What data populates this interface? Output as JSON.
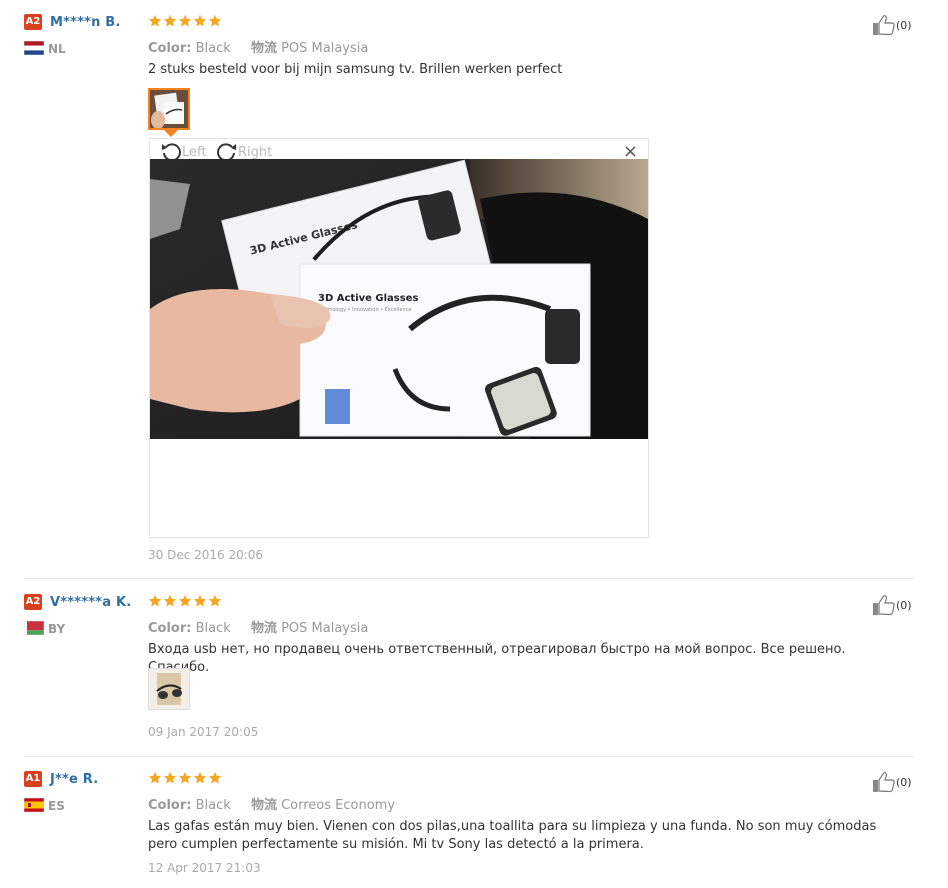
{
  "icons": {
    "rating": "star-icon",
    "helpful": "thumbs-up-icon",
    "rotate_left": "rotate-left-icon",
    "rotate_right": "rotate-right-icon",
    "close": "close-icon"
  },
  "colors": {
    "star": "#f5a623",
    "username": "#2f6ea3",
    "badge": "#d9411e",
    "active_thumb_border": "#f5811f"
  },
  "viewer": {
    "left_label": "Left",
    "right_label": "Right",
    "close_label": "×"
  },
  "reviews": [
    {
      "badge": "A2",
      "username": "M****n B.",
      "country": "NL",
      "flag": "netherlands",
      "rating": 5,
      "color_label": "Color:",
      "color_value": "Black",
      "shipping_label": "物流",
      "shipping_value": "POS Malaysia",
      "text": "2 stuks besteld voor bij mijn samsung tv. Brillen werken perfect",
      "photo_text_1": "3D Active Glasses",
      "photo_text_2": "3D Active Glasses",
      "photo_subtext": "Technology • Innovation • Excellence",
      "date": "30 Dec 2016 20:06",
      "likes": "(0)"
    },
    {
      "badge": "A2",
      "username": "V******a K.",
      "country": "BY",
      "flag": "belarus",
      "rating": 5,
      "color_label": "Color:",
      "color_value": "Black",
      "shipping_label": "物流",
      "shipping_value": "POS Malaysia",
      "text": "Входа usb нет, но продавец очень ответственный, отреагировал быстро на мой вопрос. Все решено. Спасибо.",
      "date": "09 Jan 2017 20:05",
      "likes": "(0)"
    },
    {
      "badge": "A1",
      "username": "J**e R.",
      "country": "ES",
      "flag": "spain",
      "rating": 5,
      "color_label": "Color:",
      "color_value": "Black",
      "shipping_label": "物流",
      "shipping_value": "Correos Economy",
      "text": "Las gafas están muy bien. Vienen con dos pilas,una toallita para su limpieza y una funda. No son muy cómodas pero cumplen perfectamente su misión. Mi tv Sony las detectó a la primera.",
      "date": "12 Apr 2017 21:03",
      "likes": "(0)"
    }
  ]
}
